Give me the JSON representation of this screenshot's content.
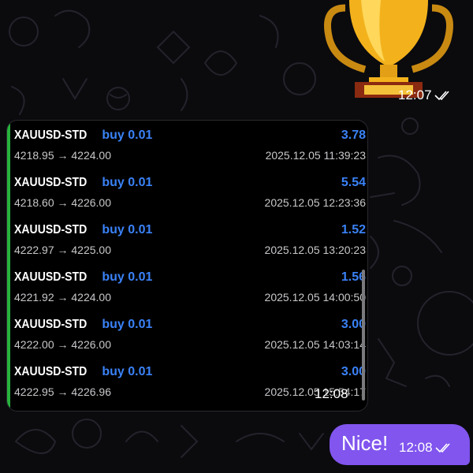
{
  "sticker": {
    "icon": "trophy-icon",
    "time": "12:07"
  },
  "trade_message": {
    "accent_color": "#27b33d",
    "value_color": "#3a82f7",
    "trades": [
      {
        "symbol": "XAUUSD-STD",
        "side": "buy 0.01",
        "profit": "3.78",
        "prices": "4218.95 → 4224.00",
        "timestamp": "2025.12.05 11:39:23"
      },
      {
        "symbol": "XAUUSD-STD",
        "side": "buy 0.01",
        "profit": "5.54",
        "prices": "4218.60 → 4226.00",
        "timestamp": "2025.12.05 12:23:36"
      },
      {
        "symbol": "XAUUSD-STD",
        "side": "buy 0.01",
        "profit": "1.52",
        "prices": "4222.97 → 4225.00",
        "timestamp": "2025.12.05 13:20:23"
      },
      {
        "symbol": "XAUUSD-STD",
        "side": "buy 0.01",
        "profit": "1.56",
        "prices": "4221.92 → 4224.00",
        "timestamp": "2025.12.05 14:00:50"
      },
      {
        "symbol": "XAUUSD-STD",
        "side": "buy 0.01",
        "profit": "3.00",
        "prices": "4222.00 → 4226.00",
        "timestamp": "2025.12.05 14:03:14"
      },
      {
        "symbol": "XAUUSD-STD",
        "side": "buy 0.01",
        "profit": "3.00",
        "prices": "4222.95 → 4226.96",
        "timestamp": "2025.12.05 15:54:17"
      }
    ],
    "time": "12:08"
  },
  "reply": {
    "text": "Nice!",
    "time": "12:08",
    "bubble_color": "#8155ee"
  },
  "icons": {
    "read_receipt": "double-check-icon"
  }
}
